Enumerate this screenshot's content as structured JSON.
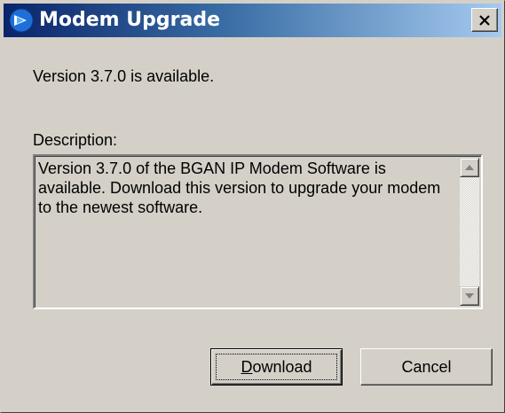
{
  "window": {
    "title": "Modem Upgrade",
    "icon": "modem-app-icon",
    "close_glyph": "✕",
    "colors": {
      "titlebar_start": "#0a246a",
      "titlebar_end": "#a6caf0",
      "face": "#d4d0c8"
    }
  },
  "main": {
    "version_text": "Version 3.7.0 is available.",
    "description_label": "Description:",
    "description_text": "Version 3.7.0 of the BGAN IP Modem Software is available. Download this version to upgrade your modem to the newest software."
  },
  "buttons": {
    "download_mnemonic": "D",
    "download_rest": "ownload",
    "cancel_label": "Cancel"
  }
}
